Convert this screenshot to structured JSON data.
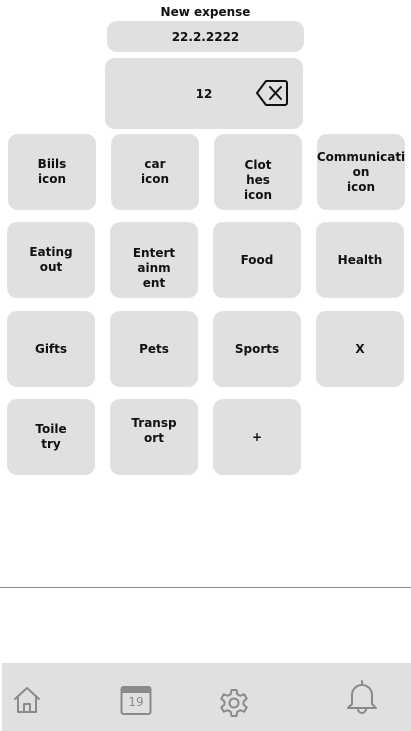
{
  "header": {
    "title": "New expense"
  },
  "date_field": {
    "value": "22.2.2222"
  },
  "amount_field": {
    "value": "12"
  },
  "categories": [
    {
      "label": "Biils\nicon"
    },
    {
      "label": "car\nicon"
    },
    {
      "label": "Clot\nhes\nicon"
    },
    {
      "label": "Communicati\non\nicon"
    },
    {
      "label": "Eating\nout"
    },
    {
      "label": "Entert\nainm\nent"
    },
    {
      "label": "Food"
    },
    {
      "label": "Health"
    },
    {
      "label": "Gifts"
    },
    {
      "label": "Pets"
    },
    {
      "label": "Sports"
    },
    {
      "label": "X"
    },
    {
      "label": "Toile\ntry"
    },
    {
      "label": "Transp\nort"
    },
    {
      "label": "+"
    }
  ],
  "tabbar": {
    "items": [
      {
        "icon": "home-icon"
      },
      {
        "icon": "calendar-icon",
        "day": "19"
      },
      {
        "icon": "gear-icon"
      },
      {
        "icon": "bell-icon"
      }
    ]
  },
  "colors": {
    "tile": "#e0e0e0",
    "icon_stroke": "#8a8a8a",
    "divider": "#8c8c8c"
  }
}
